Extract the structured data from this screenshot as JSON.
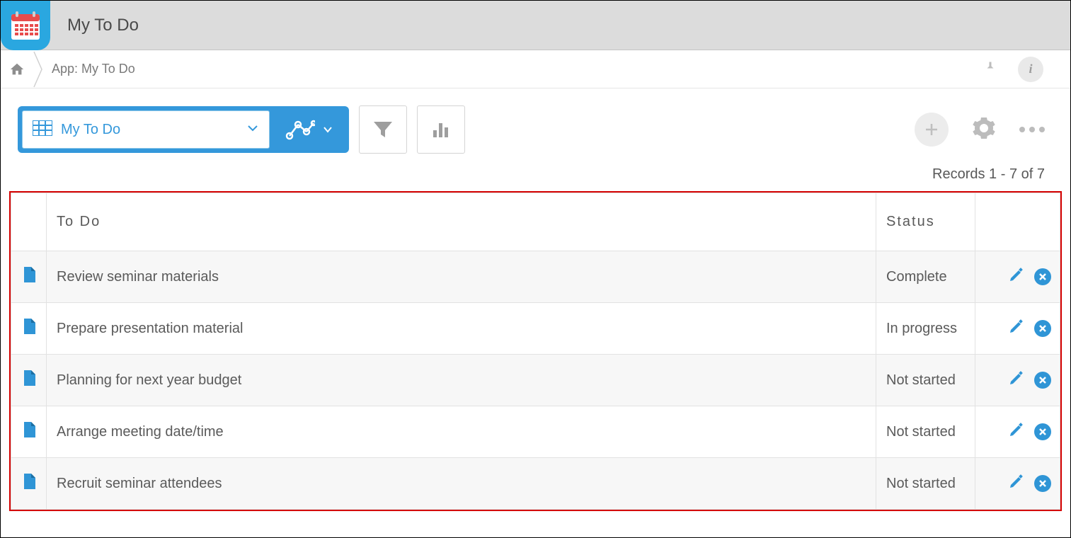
{
  "header": {
    "title": "My To Do"
  },
  "breadcrumb": {
    "text": "App: My To Do"
  },
  "toolbar": {
    "view_label": "My To Do"
  },
  "records_count": "Records 1 - 7 of 7",
  "table": {
    "headers": {
      "todo": "To Do",
      "status": "Status"
    },
    "rows": [
      {
        "todo": "Review seminar materials",
        "status": "Complete"
      },
      {
        "todo": "Prepare presentation material",
        "status": "In progress"
      },
      {
        "todo": "Planning for next year budget",
        "status": "Not started"
      },
      {
        "todo": "Arrange meeting date/time",
        "status": "Not started"
      },
      {
        "todo": "Recruit seminar attendees",
        "status": "Not started"
      }
    ]
  }
}
